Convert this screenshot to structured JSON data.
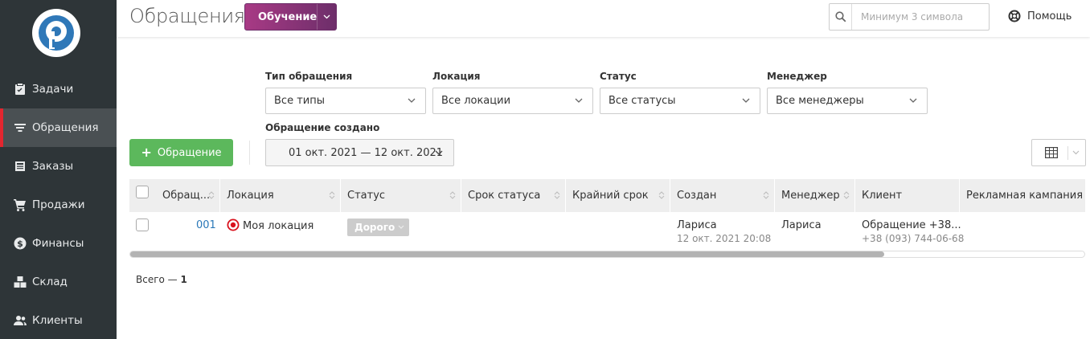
{
  "app": {
    "accent_color": "#e3262f",
    "logo": "remonline-logo"
  },
  "sidebar": {
    "items": [
      {
        "label": "Задачи",
        "icon": "clipboard-icon"
      },
      {
        "label": "Обращения",
        "icon": "filter-icon",
        "active": true
      },
      {
        "label": "Заказы",
        "icon": "notebook-icon"
      },
      {
        "label": "Продажи",
        "icon": "cart-icon"
      },
      {
        "label": "Финансы",
        "icon": "dollar-icon"
      },
      {
        "label": "Склад",
        "icon": "boxes-icon"
      },
      {
        "label": "Клиенты",
        "icon": "users-icon"
      }
    ]
  },
  "header": {
    "title": "Обращения",
    "learn_label": "Обучение",
    "search_placeholder": "Минимум 3 символа",
    "help_label": "Помощь"
  },
  "filters": {
    "type": {
      "label": "Тип обращения",
      "value": "Все типы"
    },
    "location": {
      "label": "Локация",
      "value": "Все локации"
    },
    "status": {
      "label": "Статус",
      "value": "Все статусы"
    },
    "manager": {
      "label": "Менеджер",
      "value": "Все менеджеры"
    },
    "created": {
      "label": "Обращение создано",
      "value": "01 окт. 2021 — 12 окт. 2021"
    }
  },
  "actions": {
    "add_label": "Обращение"
  },
  "table": {
    "columns": [
      "Обращ...",
      "Локация",
      "Статус",
      "Срок статуса",
      "Крайний срок",
      "Создан",
      "Менеджер",
      "Клиент",
      "Рекламная кампания"
    ],
    "rows": [
      {
        "id": "001",
        "location": "Моя локация",
        "status": "Дорого",
        "status_color": "#cccccc",
        "created_by": "Лариса",
        "created_at": "12 окт. 2021 20:08",
        "manager": "Лариса",
        "client_name": "Обращение +38...",
        "client_phone": "+38 (093) 744-06-68"
      }
    ],
    "scroll_fraction": 0.79
  },
  "footer": {
    "total_label": "Всего —",
    "total_value": "1"
  }
}
